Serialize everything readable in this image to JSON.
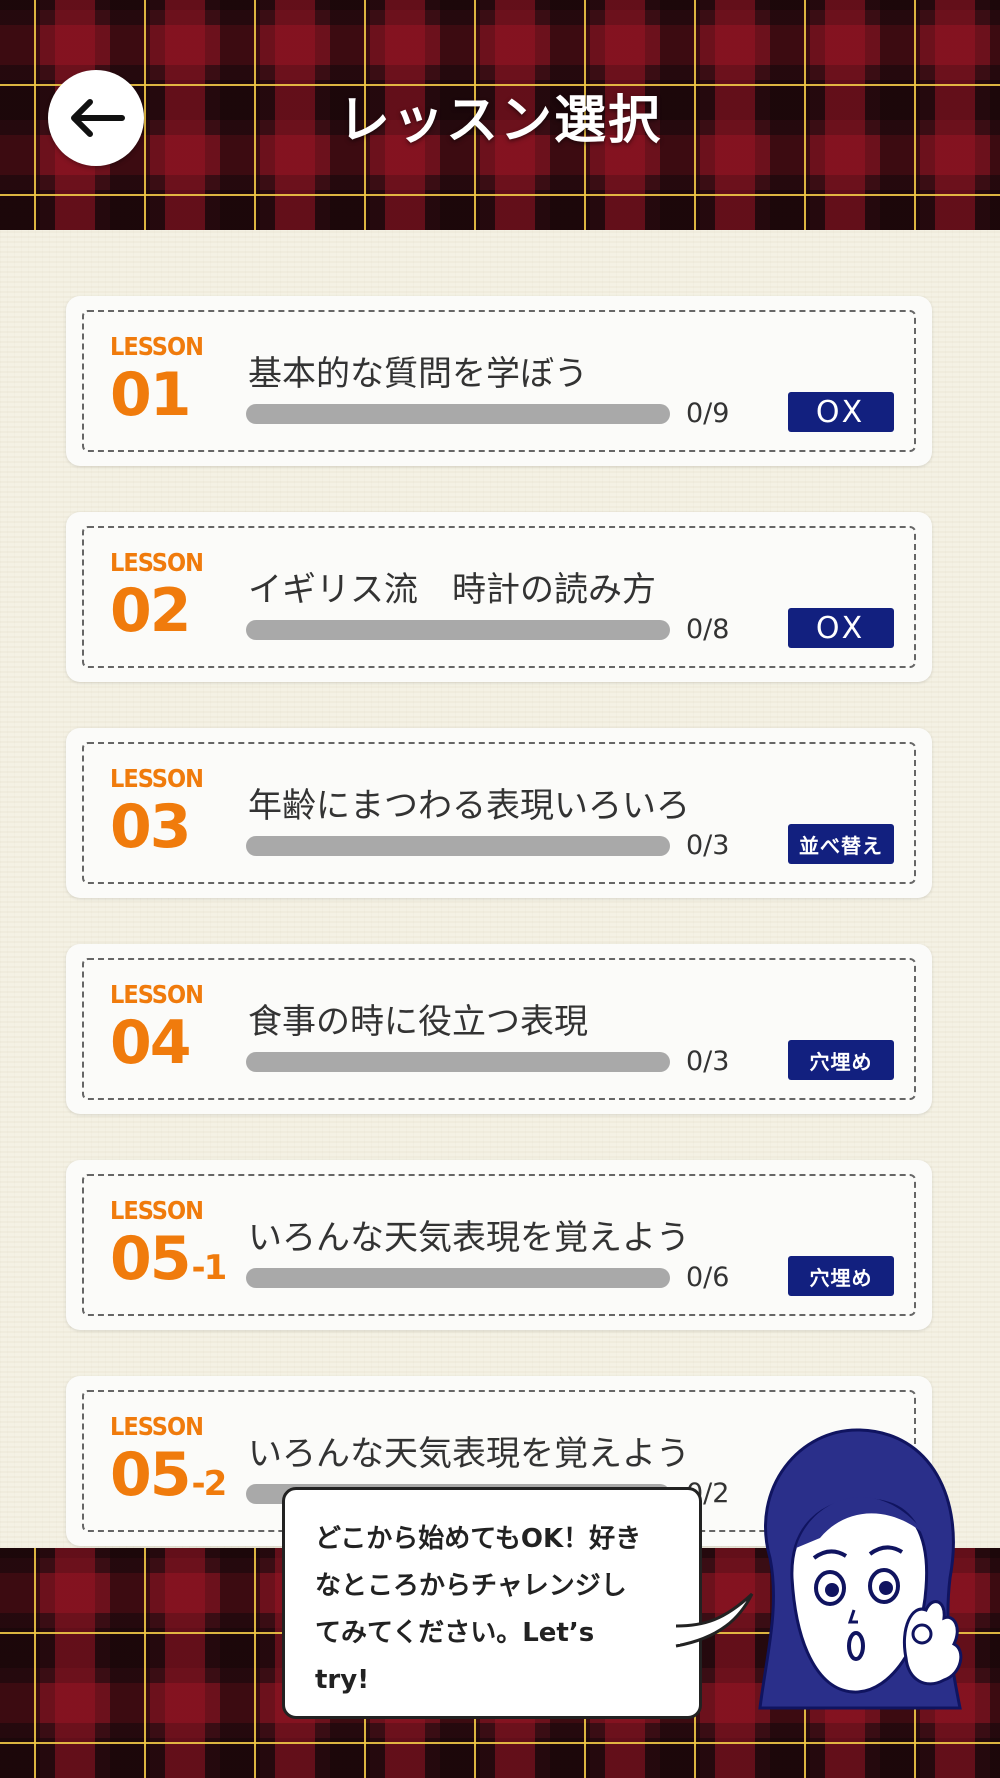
{
  "header": {
    "title": "レッスン選択",
    "back_icon": "arrow-left-icon"
  },
  "lessons": [
    {
      "label": "LESSON",
      "number": "01",
      "sub": "",
      "title": "基本的な質問を学ぼう",
      "progress": "0/9",
      "done": 0,
      "total": 9,
      "type": "OX",
      "type_style": "ox"
    },
    {
      "label": "LESSON",
      "number": "02",
      "sub": "",
      "title": "イギリス流　時計の読み方",
      "progress": "0/8",
      "done": 0,
      "total": 8,
      "type": "OX",
      "type_style": "ox"
    },
    {
      "label": "LESSON",
      "number": "03",
      "sub": "",
      "title": "年齢にまつわる表現いろいろ",
      "progress": "0/3",
      "done": 0,
      "total": 3,
      "type": "並べ替え",
      "type_style": "text"
    },
    {
      "label": "LESSON",
      "number": "04",
      "sub": "",
      "title": "食事の時に役立つ表現",
      "progress": "0/3",
      "done": 0,
      "total": 3,
      "type": "穴埋め",
      "type_style": "text"
    },
    {
      "label": "LESSON",
      "number": "05",
      "sub": "-1",
      "title": "いろんな天気表現を覚えよう",
      "progress": "0/6",
      "done": 0,
      "total": 6,
      "type": "穴埋め",
      "type_style": "text"
    },
    {
      "label": "LESSON",
      "number": "05",
      "sub": "-2",
      "title": "いろんな天気表現を覚えよう",
      "progress": "0/2",
      "done": 0,
      "total": 2,
      "type": "",
      "type_style": "hidden"
    }
  ],
  "bubble": {
    "lines": [
      "どこから始めてもOK！好き",
      "なところからチャレンジし",
      "てみてください。Let’s",
      "try!"
    ]
  },
  "colors": {
    "accent_orange": "#f07b0c",
    "badge_navy": "#12207f",
    "progress_track": "#a9a9a9",
    "tartan_red": "#3a0d14"
  }
}
